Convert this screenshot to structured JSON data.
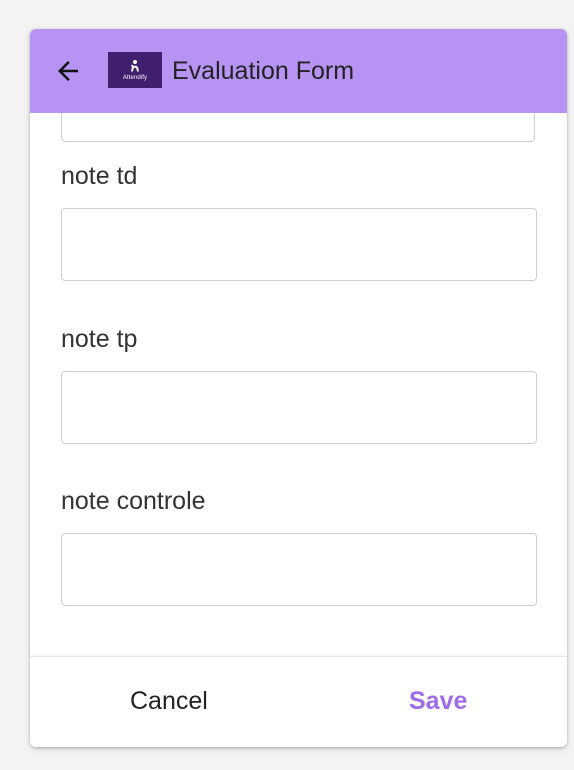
{
  "header": {
    "title": "Evaluation Form",
    "back_icon": "arrow-left-icon",
    "logo_text": "Attendify",
    "background_color": "#b794f4",
    "logo_background_color": "#3f1f6e"
  },
  "form": {
    "fields": [
      {
        "label": "note td",
        "value": ""
      },
      {
        "label": "note tp",
        "value": ""
      },
      {
        "label": "note controle",
        "value": ""
      }
    ]
  },
  "footer": {
    "cancel_label": "Cancel",
    "save_label": "Save",
    "save_color": "#9f6ce7"
  }
}
